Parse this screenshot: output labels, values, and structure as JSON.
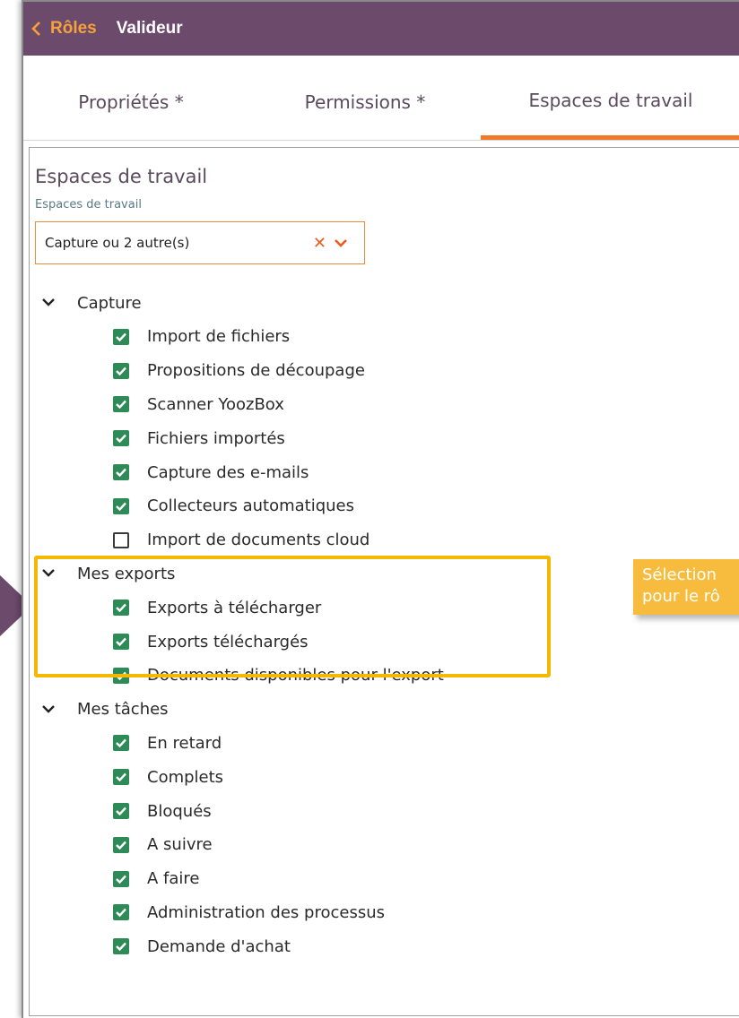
{
  "header": {
    "back_label": "Rôles",
    "title": "Valideur"
  },
  "tabs": [
    {
      "label": "Propriétés *",
      "active": false
    },
    {
      "label": "Permissions *",
      "active": false
    },
    {
      "label": "Espaces de travail",
      "active": true
    }
  ],
  "section": {
    "title": "Espaces de travail",
    "field_label": "Espaces de travail",
    "select_value": "Capture ou 2 autre(s)"
  },
  "groups": [
    {
      "label": "Capture",
      "items": [
        {
          "label": "Import de fichiers",
          "checked": true
        },
        {
          "label": "Propositions de découpage",
          "checked": true
        },
        {
          "label": "Scanner YoozBox",
          "checked": true
        },
        {
          "label": "Fichiers importés",
          "checked": true
        },
        {
          "label": "Capture des e-mails",
          "checked": true
        },
        {
          "label": "Collecteurs automatiques",
          "checked": true
        },
        {
          "label": "Import de documents cloud",
          "checked": false
        }
      ]
    },
    {
      "label": "Mes exports",
      "items": [
        {
          "label": "Exports à télécharger",
          "checked": true
        },
        {
          "label": "Exports téléchargés",
          "checked": true
        },
        {
          "label": "Documents disponibles pour l'export",
          "checked": true
        }
      ]
    },
    {
      "label": "Mes tâches",
      "items": [
        {
          "label": "En retard",
          "checked": true
        },
        {
          "label": "Complets",
          "checked": true
        },
        {
          "label": "Bloqués",
          "checked": true
        },
        {
          "label": "A suivre",
          "checked": true
        },
        {
          "label": "A faire",
          "checked": true
        },
        {
          "label": "Administration des processus",
          "checked": true
        },
        {
          "label": "Demande d'achat",
          "checked": true
        }
      ]
    }
  ],
  "callout": {
    "line1": "Sélection",
    "line2": "pour le rô"
  },
  "colors": {
    "header_bg": "#6b4a6c",
    "back_accent": "#f6a23a",
    "tab_active": "#f07a2a",
    "checkbox_on": "#2e8b57",
    "highlight": "#f5b800",
    "callout_bg": "#f7bc3e"
  }
}
